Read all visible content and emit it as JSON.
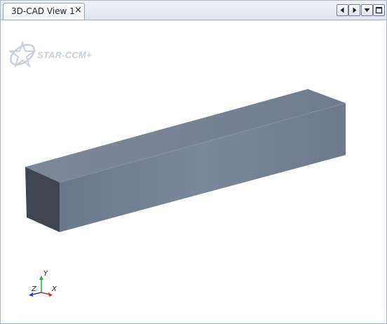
{
  "tab": {
    "title": "3D-CAD View 1",
    "close_glyph": "×"
  },
  "controls": [
    {
      "name": "scroll-left-icon"
    },
    {
      "name": "scroll-right-icon"
    },
    {
      "name": "dropdown-icon"
    },
    {
      "name": "maximize-icon"
    }
  ],
  "logo": {
    "text": "STAR-CCM+",
    "icon": "star-orbit-logo"
  },
  "triad": {
    "x_label": "X",
    "y_label": "Y",
    "z_label": "Z"
  },
  "colors": {
    "axis_x": "#d22a2a",
    "axis_y": "#2aa83a",
    "axis_z": "#2a3ad0",
    "model_top": "#7a8797",
    "model_front": "#6d7c8f",
    "model_end": "#3f4652"
  }
}
